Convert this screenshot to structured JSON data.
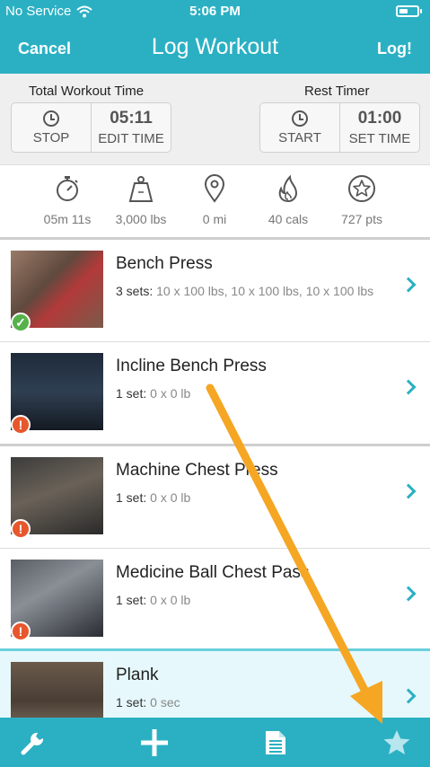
{
  "status": {
    "carrier": "No Service",
    "time": "5:06 PM"
  },
  "nav": {
    "cancel": "Cancel",
    "title": "Log Workout",
    "log": "Log!"
  },
  "total_timer": {
    "label": "Total Workout Time",
    "stop": "STOP",
    "time": "05:11",
    "edit": "EDIT TIME"
  },
  "rest_timer": {
    "label": "Rest Timer",
    "start": "START",
    "time": "01:00",
    "set": "SET TIME"
  },
  "stats": {
    "duration": "05m 11s",
    "weight": "3,000 lbs",
    "distance": "0 mi",
    "calories": "40 cals",
    "points": "727 pts"
  },
  "exercises": [
    {
      "name": "Bench Press",
      "sets_count": "3 sets:",
      "sets_detail": " 10 x 100 lbs, 10 x 100 lbs, 10 x 100 lbs",
      "status": "done"
    },
    {
      "name": "Incline Bench Press",
      "sets_count": "1 set:",
      "sets_detail": " 0 x 0 lb",
      "status": "warning"
    },
    {
      "name": "Machine Chest Press",
      "sets_count": "1 set:",
      "sets_detail": " 0 x 0 lb",
      "status": "warning"
    },
    {
      "name": "Medicine Ball Chest Pass",
      "sets_count": "1 set:",
      "sets_detail": " 0 x 0 lb",
      "status": "warning"
    },
    {
      "name": "Plank",
      "sets_count": "1 set:",
      "sets_detail": " 0 sec",
      "status": "none"
    }
  ],
  "colors": {
    "accent": "#2bb0c3",
    "success": "#55b24a",
    "warning": "#e7572d",
    "annotation_arrow": "#f5a623"
  },
  "tabbar": {
    "icons": [
      "wrench-icon",
      "plus-icon",
      "document-icon",
      "star-icon"
    ]
  }
}
